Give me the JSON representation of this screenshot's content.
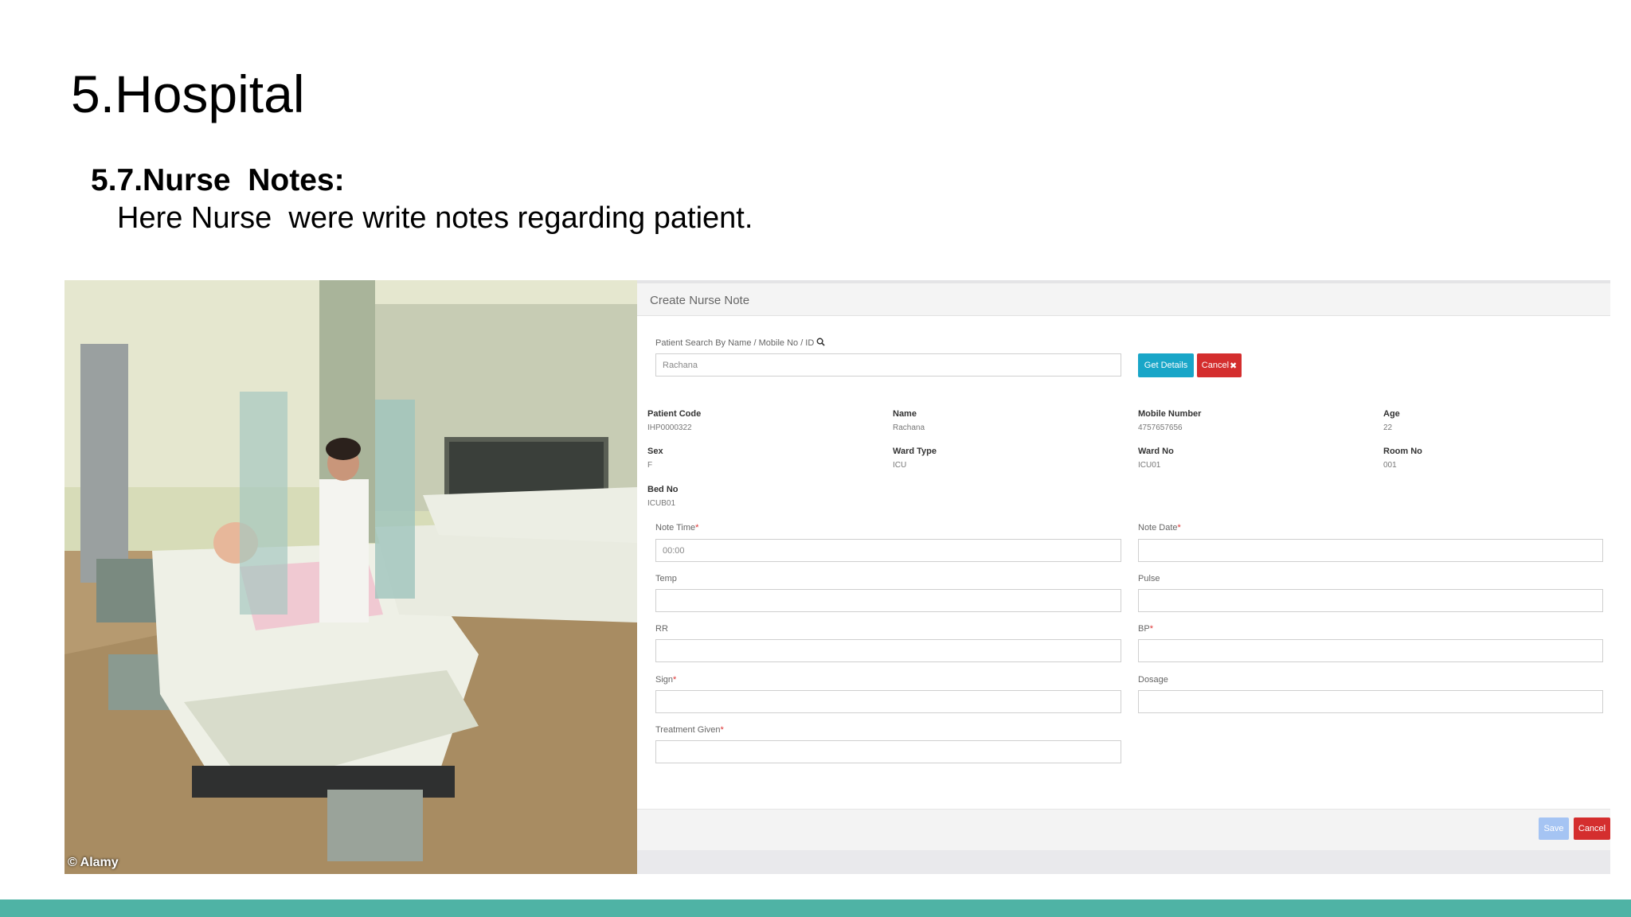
{
  "slide": {
    "title": "5.Hospital",
    "heading": "5.7.Nurse  Notes:",
    "description": "Here Nurse  were write notes regarding patient.",
    "accent_color": "#4fb3a5"
  },
  "photo": {
    "credit": "© Alamy"
  },
  "form": {
    "title": "Create Nurse Note",
    "search": {
      "label": "Patient Search By Name / Mobile No / ID",
      "icon": "search-icon",
      "value": "Rachana"
    },
    "buttons": {
      "get_details": "Get Details",
      "cancel_top": "Cancel",
      "save": "Save",
      "cancel_bottom": "Cancel"
    },
    "patient": {
      "patient_code_label": "Patient Code",
      "patient_code": "IHP0000322",
      "name_label": "Name",
      "name": "Rachana",
      "mobile_label": "Mobile Number",
      "mobile": "4757657656",
      "age_label": "Age",
      "age": "22",
      "sex_label": "Sex",
      "sex": "F",
      "ward_type_label": "Ward Type",
      "ward_type": "ICU",
      "ward_no_label": "Ward No",
      "ward_no": "ICU01",
      "room_no_label": "Room No",
      "room_no": "001",
      "bed_no_label": "Bed No",
      "bed_no": "ICUB01"
    },
    "fields": {
      "note_time_label": "Note Time",
      "note_time_value": "00:00",
      "note_date_label": "Note Date",
      "temp_label": "Temp",
      "pulse_label": "Pulse",
      "rr_label": "RR",
      "bp_label": "BP",
      "sign_label": "Sign",
      "dosage_label": "Dosage",
      "treatment_label": "Treatment Given",
      "required_mark": "*"
    }
  }
}
